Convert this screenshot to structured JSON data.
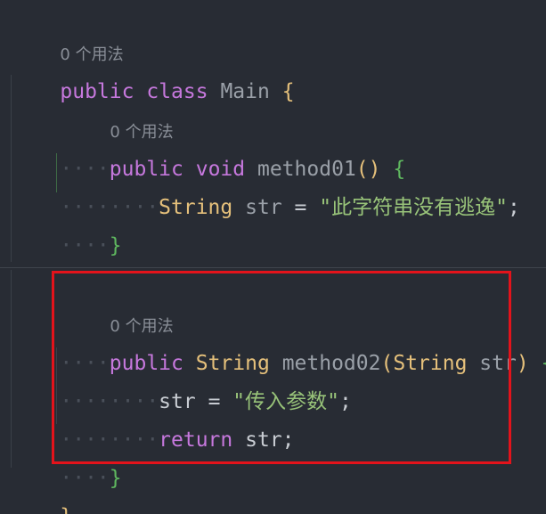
{
  "usage_hint": "0 个用法",
  "code": {
    "class_decl": {
      "modifier": "public",
      "keyword": "class",
      "name": "Main",
      "open": "{"
    },
    "method01": {
      "modifier": "public",
      "return_type": "void",
      "name": "method01",
      "params": "()",
      "open": "{",
      "body": {
        "type": "String",
        "var": "str",
        "op": "=",
        "value": "\"此字符串没有逃逸\"",
        "end": ";"
      },
      "close": "}"
    },
    "method02": {
      "modifier": "public",
      "return_type": "String",
      "name": "method02",
      "paren_open": "(",
      "param_type": "String",
      "param_name": "str",
      "paren_close": ")",
      "open": "{",
      "assign": {
        "var": "str",
        "op": "=",
        "value": "\"传入参数\"",
        "end": ";"
      },
      "ret": {
        "keyword": "return",
        "var": "str",
        "end": ";"
      },
      "close": "}"
    },
    "class_close": "}"
  },
  "indent_marker": "····",
  "colors": {
    "background": "#282c34",
    "keyword": "#c678dd",
    "type": "#e5c07b",
    "string": "#98c379",
    "highlight_border": "#e3131b"
  }
}
